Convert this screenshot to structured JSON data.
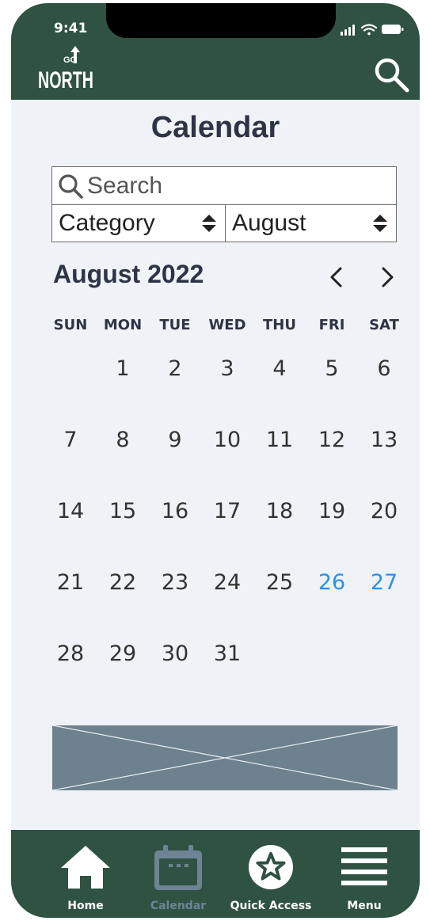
{
  "status": {
    "time": "9:41"
  },
  "header": {
    "logo_small": "GO",
    "logo_text": "NORTH"
  },
  "page": {
    "title": "Calendar"
  },
  "filters": {
    "search_placeholder": "Search",
    "category_label": "Category",
    "month_label": "August"
  },
  "calendar": {
    "month_title": "August 2022",
    "weekdays": [
      "SUN",
      "MON",
      "TUE",
      "WED",
      "THU",
      "FRI",
      "SAT"
    ],
    "weeks": [
      [
        "",
        "1",
        "2",
        "3",
        "4",
        "5",
        "6"
      ],
      [
        "7",
        "8",
        "9",
        "10",
        "11",
        "12",
        "13"
      ],
      [
        "14",
        "15",
        "16",
        "17",
        "18",
        "19",
        "20"
      ],
      [
        "21",
        "22",
        "23",
        "24",
        "25",
        "26",
        "27"
      ],
      [
        "28",
        "29",
        "30",
        "31",
        "",
        "",
        ""
      ]
    ],
    "highlighted_days": [
      "26",
      "27"
    ],
    "highlight_color": "#2f8fe8"
  },
  "tabs": [
    {
      "label": "Home",
      "icon": "house-icon"
    },
    {
      "label": "Calendar",
      "icon": "calendar-icon",
      "active": true
    },
    {
      "label": "Quick Access",
      "icon": "star-icon"
    },
    {
      "label": "Menu",
      "icon": "hamburger-icon"
    }
  ],
  "colors": {
    "brand_green": "#2f5243",
    "background": "#eff3f7",
    "text_dark": "#2d3446",
    "inactive_tab": "#6e8394",
    "banner_placeholder": "#6e818e"
  }
}
